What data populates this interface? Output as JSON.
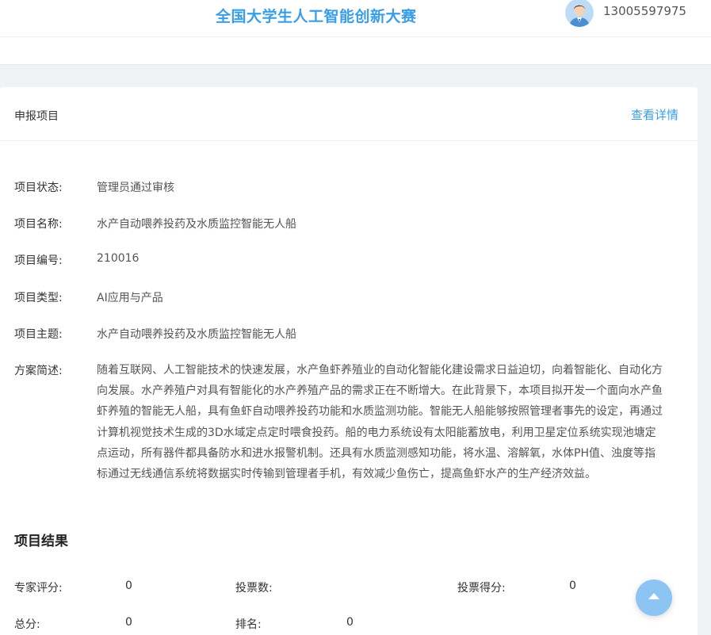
{
  "header": {
    "site_title": "全国大学生人工智能创新大赛",
    "user_phone": "13005597975",
    "avatar_icon": "user-avatar-icon"
  },
  "card": {
    "title": "申报项目",
    "detail_link": "查看详情"
  },
  "fields": [
    {
      "label": "项目状态:",
      "value": "管理员通过审核"
    },
    {
      "label": "项目名称:",
      "value": "水产自动喂养投药及水质监控智能无人船"
    },
    {
      "label": "项目编号:",
      "value": "210016"
    },
    {
      "label": "项目类型:",
      "value": "AI应用与产品"
    },
    {
      "label": "项目主题:",
      "value": "水产自动喂养投药及水质监控智能无人船"
    }
  ],
  "summary": {
    "label": "方案简述:",
    "text": "随着互联网、人工智能技术的快速发展，水产鱼虾养殖业的自动化智能化建设需求日益迫切，向着智能化、自动化方向发展。水产养殖户对具有智能化的水产养殖产品的需求正在不断增大。在此背景下，本项目拟开发一个面向水产鱼虾养殖的智能无人船，具有鱼虾自动喂养投药功能和水质监测功能。智能无人船能够按照管理者事先的设定，再通过计算机视觉技术生成的3D水域定点定时喂食投药。船的电力系统设有太阳能蓄放电，利用卫星定位系统实现池塘定点运动，所有器件都具备防水和进水报警机制。还具有水质监测感知功能，将水温、溶解氧，水体PH值、浊度等指标通过无线通信系统将数据实时传输到管理者手机，有效减少鱼伤亡，提高鱼虾水产的生产经济效益。"
  },
  "results": {
    "title": "项目结果",
    "expert_score_label": "专家评分:",
    "expert_score": "0",
    "votes_label": "投票数:",
    "votes": "",
    "vote_score_label": "投票得分:",
    "vote_score": "0",
    "total_label": "总分:",
    "total": "0",
    "rank_label": "排名:",
    "rank": "0"
  },
  "colors": {
    "accent": "#3a9ee6",
    "scroll_button": "#8cc4f3"
  },
  "scroll_top_icon": "arrow-up-icon"
}
